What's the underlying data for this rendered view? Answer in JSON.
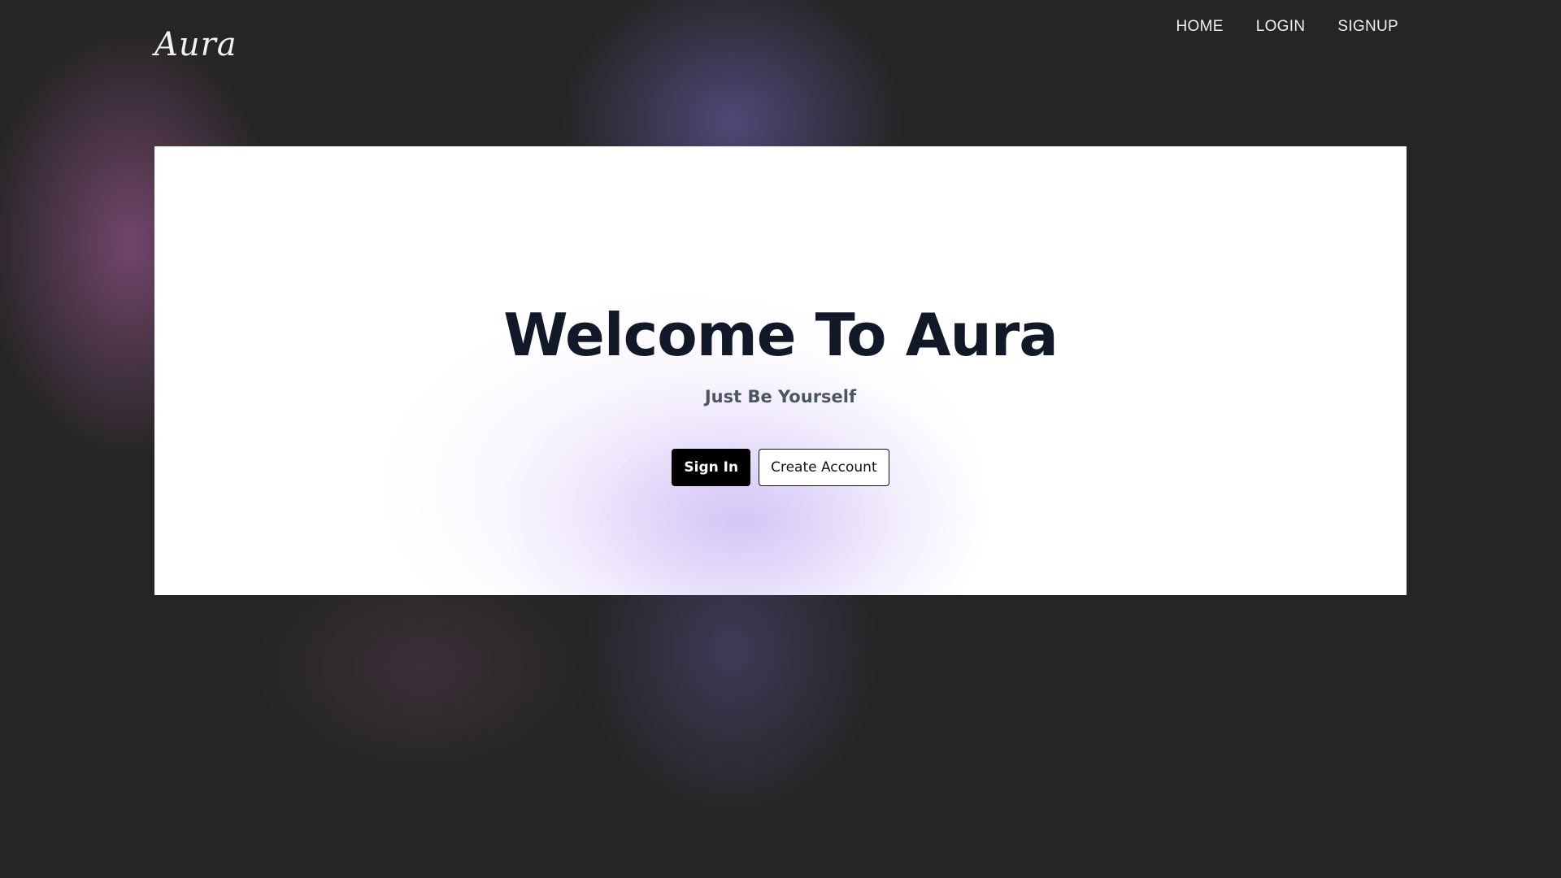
{
  "brand": {
    "logo_text": "Aura"
  },
  "nav": {
    "items": [
      {
        "label": "HOME"
      },
      {
        "label": "LOGIN"
      },
      {
        "label": "SIGNUP"
      }
    ]
  },
  "hero": {
    "title": "Welcome To Aura",
    "subtitle": "Just Be Yourself",
    "primary_button": "Sign In",
    "secondary_button": "Create Account"
  },
  "colors": {
    "page_background": "#252525",
    "card_background": "#ffffff",
    "title_color": "#111827",
    "subtitle_color": "#4b5563",
    "primary_button_bg": "#000000",
    "accent_glow": "#cdbef5"
  }
}
